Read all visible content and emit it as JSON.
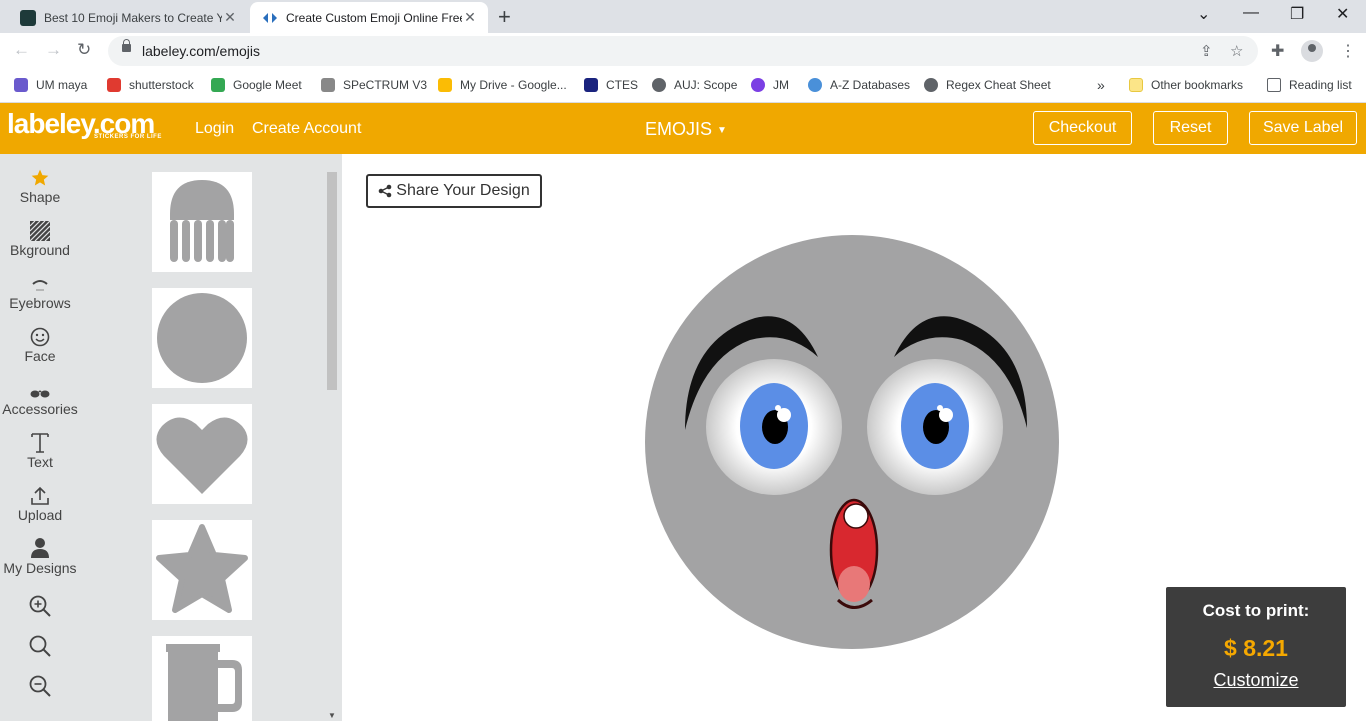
{
  "browser": {
    "tabs": [
      {
        "title": "Best 10 Emoji Makers to Create Y",
        "favicon_color": "#1e3a3a"
      },
      {
        "title": "Create Custom Emoji Online Free",
        "favicon_color": "#2a6fbd"
      }
    ],
    "url": "labeley.com/emojis",
    "bookmarks": [
      {
        "label": "UM maya",
        "color": "#6a5acd"
      },
      {
        "label": "shutterstock",
        "color": "#e03a30"
      },
      {
        "label": "Google Meet",
        "color": "#34a853"
      },
      {
        "label": "SPeCTRUM V3",
        "color": "#888888"
      },
      {
        "label": "My Drive - Google...",
        "color": "#fbbc05"
      },
      {
        "label": "CTES",
        "color": "#1a237e"
      },
      {
        "label": "AUJ: Scope",
        "color": "#5f6368"
      },
      {
        "label": "JM",
        "color": "#7b3fe4"
      },
      {
        "label": "A-Z Databases",
        "color": "#4a90d9"
      },
      {
        "label": "Regex Cheat Sheet",
        "color": "#5f6368"
      }
    ],
    "overflow_label": "»",
    "other_bookmarks": "Other bookmarks",
    "reading_list": "Reading list"
  },
  "site": {
    "logo": "labeley.com",
    "logo_tagline": "STICKERS FOR LIFE",
    "login": "Login",
    "create_account": "Create Account",
    "category": "EMOJIS",
    "checkout": "Checkout",
    "reset": "Reset",
    "save_label": "Save Label",
    "brand_color": "#f0a800"
  },
  "nav": {
    "items": [
      {
        "label": "Shape",
        "icon": "star-icon"
      },
      {
        "label": "Bkground",
        "icon": "pattern-icon"
      },
      {
        "label": "Eyebrows",
        "icon": "eyebrow-icon"
      },
      {
        "label": "Face",
        "icon": "smiley-icon"
      },
      {
        "label": "Accessories",
        "icon": "glasses-icon"
      },
      {
        "label": "Text",
        "icon": "text-icon"
      },
      {
        "label": "Upload",
        "icon": "upload-icon"
      },
      {
        "label": "My Designs",
        "icon": "user-icon"
      }
    ],
    "zoom_icons": [
      "zoom-in-icon",
      "zoom-reset-icon",
      "zoom-out-icon"
    ]
  },
  "shapes": [
    "jellyfish",
    "circle",
    "heart",
    "star",
    "mug"
  ],
  "canvas": {
    "share_label": "Share Your Design",
    "face_color": "#a3a3a4",
    "iris_color": "#5b8ee6"
  },
  "cost": {
    "label": "Cost to print:",
    "value": "$ 8.21",
    "link": "Customize"
  }
}
